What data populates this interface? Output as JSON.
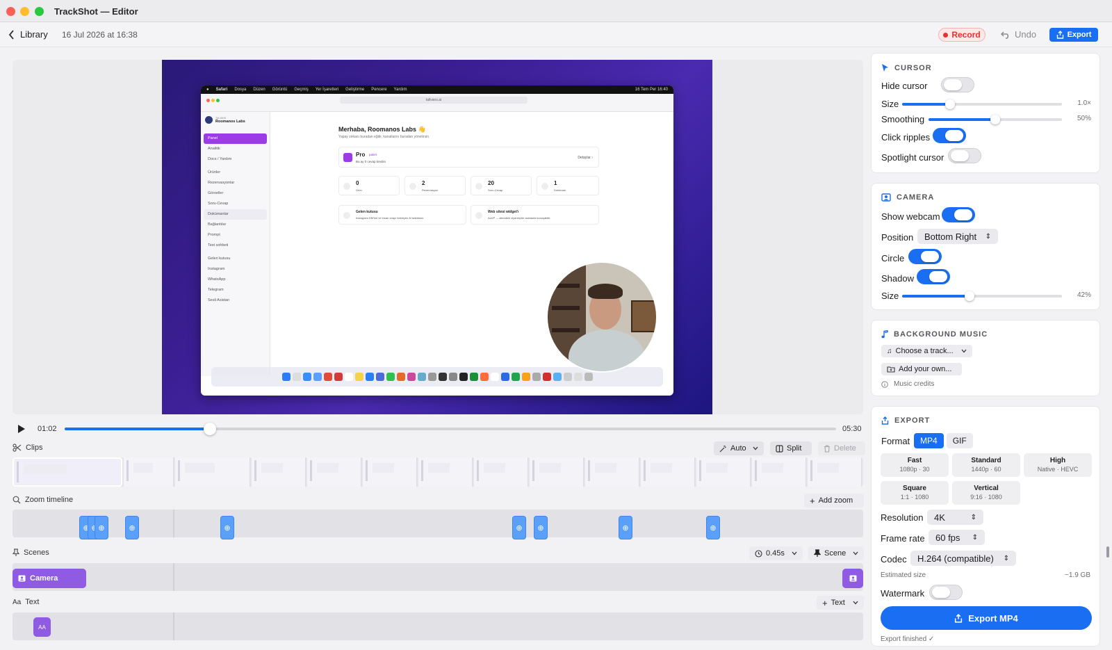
{
  "window": {
    "title": "TrackShot — Editor"
  },
  "toolbar": {
    "back_label": "Library",
    "timestamp": "16 Jul 2026 at 16:38",
    "record_label": "Record",
    "undo_label": "Undo",
    "export_label": "Export"
  },
  "preview": {
    "menubar": [
      "Safari",
      "Dosya",
      "Düzen",
      "Görüntü",
      "Geçmiş",
      "Yer İşaretleri",
      "Geliştirme",
      "Pencere",
      "Yardım"
    ],
    "clock": "16 Tem Per  16:40",
    "url": "tallvans.ai",
    "org_name": "Roomanos Labs",
    "org_kicker": "TALVANS",
    "sidebar_items": [
      "Panel",
      "Analitik",
      "Docs / Yardım",
      "Ürünler",
      "Rezervasyonlar",
      "Görseller",
      "Soru-Cevap",
      "Dokümanlar",
      "Bağlantılar",
      "Prompt",
      "Test sohbeti",
      "Gelen kutusu",
      "Instagram",
      "WhatsApp",
      "Telegram",
      "Sesli Asistan"
    ],
    "greeting": "Merhaba, Roomanos Labs 👋",
    "greeting_sub": "Yapay zekanı buradan eğitir, kanallarını buradan yönetirsin.",
    "plan_name": "Pro",
    "plan_badge": "paket",
    "plan_sub": "Bu ay 0 cevap kredisi",
    "plan_link": "Detaylar  ›",
    "stats": [
      {
        "value": "0",
        "label": "Ürün"
      },
      {
        "value": "2",
        "label": "Rezervasyon"
      },
      {
        "value": "20",
        "label": "Soru-Cevap"
      },
      {
        "value": "1",
        "label": "Doküman"
      }
    ],
    "card_inbox_title": "Gelen kutusu",
    "card_inbox_sub": "Instagram DM'leri ve insan onayı bekleyen AI taslakları.",
    "card_widget_title": "Web sitesi widget'ı",
    "card_widget_sub": "AoVP — sitendeki ziyaretçiler asistanla konuşabilir."
  },
  "player": {
    "current_time": "01:02",
    "total_time": "05:30",
    "progress": 0.188
  },
  "clips": {
    "label": "Clips",
    "auto_label": "Auto",
    "split_label": "Split",
    "delete_label": "Delete"
  },
  "zoom": {
    "label": "Zoom timeline",
    "add_label": "Add zoom"
  },
  "scenes": {
    "label": "Scenes",
    "duration_label": "0.45s",
    "scene_label": "Scene",
    "camera_clip_label": "Camera"
  },
  "text_track": {
    "label": "Text",
    "add_label": "Text",
    "pill_label": "AA",
    "label_prefix": "Aa"
  },
  "cursor_panel": {
    "heading": "CURSOR",
    "hide_cursor_label": "Hide cursor",
    "hide_cursor_on": false,
    "size_label": "Size",
    "size_value": "1.0×",
    "size_fraction": 0.3,
    "smoothing_label": "Smoothing",
    "smoothing_value": "50%",
    "smoothing_fraction": 0.5,
    "click_ripples_label": "Click ripples",
    "click_ripples_on": true,
    "spotlight_label": "Spotlight cursor",
    "spotlight_on": false
  },
  "camera_panel": {
    "heading": "CAMERA",
    "show_webcam_label": "Show webcam",
    "show_webcam_on": true,
    "position_label": "Position",
    "position_value": "Bottom Right",
    "circle_label": "Circle",
    "circle_on": true,
    "shadow_label": "Shadow",
    "shadow_on": true,
    "size_label": "Size",
    "size_value": "42%",
    "size_fraction": 0.42
  },
  "music_panel": {
    "heading": "BACKGROUND MUSIC",
    "choose_label": "Choose a track...",
    "add_own_label": "Add your own...",
    "credits_label": "Music credits"
  },
  "export_panel": {
    "heading": "EXPORT",
    "format_label": "Format",
    "formats": [
      "MP4",
      "GIF"
    ],
    "selected_format": "MP4",
    "presets": [
      {
        "name": "Fast",
        "detail": "1080p · 30"
      },
      {
        "name": "Standard",
        "detail": "1440p · 60"
      },
      {
        "name": "High",
        "detail": "Native · HEVC"
      },
      {
        "name": "Square",
        "detail": "1:1 · 1080"
      },
      {
        "name": "Vertical",
        "detail": "9:16 · 1080"
      }
    ],
    "resolution_label": "Resolution",
    "resolution_value": "4K",
    "framerate_label": "Frame rate",
    "framerate_value": "60 fps",
    "codec_label": "Codec",
    "codec_value": "H.264 (compatible)",
    "estimated_label": "Estimated size",
    "estimated_value": "~1.9 GB",
    "watermark_label": "Watermark",
    "watermark_on": false,
    "export_button_label": "Export MP4",
    "status": "Export finished ✓"
  },
  "colors": {
    "accent": "#1a6ef2",
    "record": "#e5312f",
    "purple": "#8e5be2"
  }
}
